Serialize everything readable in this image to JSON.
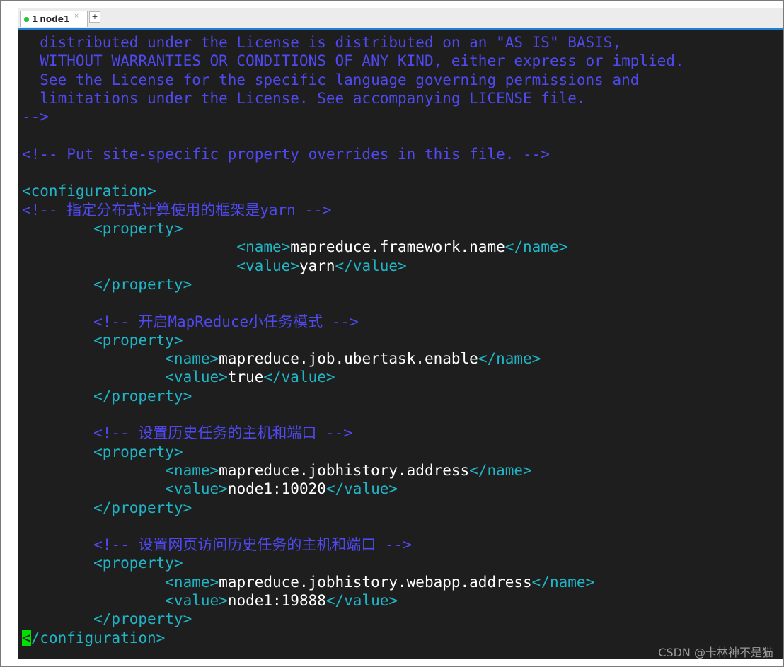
{
  "tab": {
    "number": "1",
    "title": "node1",
    "close": "×",
    "add": "+"
  },
  "lines": [
    {
      "parts": [
        {
          "cls": "c",
          "text": "  distributed under the License is distributed on an \"AS IS\" BASIS,"
        }
      ]
    },
    {
      "parts": [
        {
          "cls": "c",
          "text": "  WITHOUT WARRANTIES OR CONDITIONS OF ANY KIND, either express or implied."
        }
      ]
    },
    {
      "parts": [
        {
          "cls": "c",
          "text": "  See the License for the specific language governing permissions and"
        }
      ]
    },
    {
      "parts": [
        {
          "cls": "c",
          "text": "  limitations under the License. See accompanying LICENSE file."
        }
      ]
    },
    {
      "parts": [
        {
          "cls": "c",
          "text": "-->"
        }
      ]
    },
    {
      "parts": []
    },
    {
      "parts": [
        {
          "cls": "c",
          "text": "<!-- Put site-specific property overrides in this file. -->"
        }
      ]
    },
    {
      "parts": []
    },
    {
      "parts": [
        {
          "cls": "t",
          "text": "<configuration>"
        }
      ]
    },
    {
      "parts": [
        {
          "cls": "c",
          "text": "<!-- 指定分布式计算使用的框架是yarn -->"
        }
      ]
    },
    {
      "parts": [
        {
          "cls": "t",
          "text": "        <property>"
        }
      ]
    },
    {
      "parts": [
        {
          "cls": "t",
          "text": "                        <name>"
        },
        {
          "cls": "v",
          "text": "mapreduce.framework.name"
        },
        {
          "cls": "t",
          "text": "</name>"
        }
      ]
    },
    {
      "parts": [
        {
          "cls": "t",
          "text": "                        <value>"
        },
        {
          "cls": "v",
          "text": "yarn"
        },
        {
          "cls": "t",
          "text": "</value>"
        }
      ]
    },
    {
      "parts": [
        {
          "cls": "t",
          "text": "        </property>"
        }
      ]
    },
    {
      "parts": []
    },
    {
      "parts": [
        {
          "cls": "c",
          "text": "        <!-- 开启MapReduce小任务模式 -->"
        }
      ]
    },
    {
      "parts": [
        {
          "cls": "t",
          "text": "        <property>"
        }
      ]
    },
    {
      "parts": [
        {
          "cls": "t",
          "text": "                <name>"
        },
        {
          "cls": "v",
          "text": "mapreduce.job.ubertask.enable"
        },
        {
          "cls": "t",
          "text": "</name>"
        }
      ]
    },
    {
      "parts": [
        {
          "cls": "t",
          "text": "                <value>"
        },
        {
          "cls": "v",
          "text": "true"
        },
        {
          "cls": "t",
          "text": "</value>"
        }
      ]
    },
    {
      "parts": [
        {
          "cls": "t",
          "text": "        </property>"
        }
      ]
    },
    {
      "parts": []
    },
    {
      "parts": [
        {
          "cls": "c",
          "text": "        <!-- 设置历史任务的主机和端口 -->"
        }
      ]
    },
    {
      "parts": [
        {
          "cls": "t",
          "text": "        <property>"
        }
      ]
    },
    {
      "parts": [
        {
          "cls": "t",
          "text": "                <name>"
        },
        {
          "cls": "v",
          "text": "mapreduce.jobhistory.address"
        },
        {
          "cls": "t",
          "text": "</name>"
        }
      ]
    },
    {
      "parts": [
        {
          "cls": "t",
          "text": "                <value>"
        },
        {
          "cls": "v",
          "text": "node1:10020"
        },
        {
          "cls": "t",
          "text": "</value>"
        }
      ]
    },
    {
      "parts": [
        {
          "cls": "t",
          "text": "        </property>"
        }
      ]
    },
    {
      "parts": []
    },
    {
      "parts": [
        {
          "cls": "c",
          "text": "        <!-- 设置网页访问历史任务的主机和端口 -->"
        }
      ]
    },
    {
      "parts": [
        {
          "cls": "t",
          "text": "        <property>"
        }
      ]
    },
    {
      "parts": [
        {
          "cls": "t",
          "text": "                <name>"
        },
        {
          "cls": "v",
          "text": "mapreduce.jobhistory.webapp.address"
        },
        {
          "cls": "t",
          "text": "</name>"
        }
      ]
    },
    {
      "parts": [
        {
          "cls": "t",
          "text": "                <value>"
        },
        {
          "cls": "v",
          "text": "node1:19888"
        },
        {
          "cls": "t",
          "text": "</value>"
        }
      ]
    },
    {
      "parts": [
        {
          "cls": "t",
          "text": "        </property>"
        }
      ]
    },
    {
      "parts": [
        {
          "cls": "cursor",
          "text": "<"
        },
        {
          "cls": "t",
          "text": "/configuration>"
        }
      ]
    }
  ],
  "watermark": "CSDN @卡林神不是猫",
  "colors": {
    "comment": "#4f49ef",
    "tag": "#20b5c6",
    "value": "#ffffff",
    "cursor": "#00e000",
    "tab_accent": "#1f7fd4",
    "status_dot": "#21c53a"
  }
}
